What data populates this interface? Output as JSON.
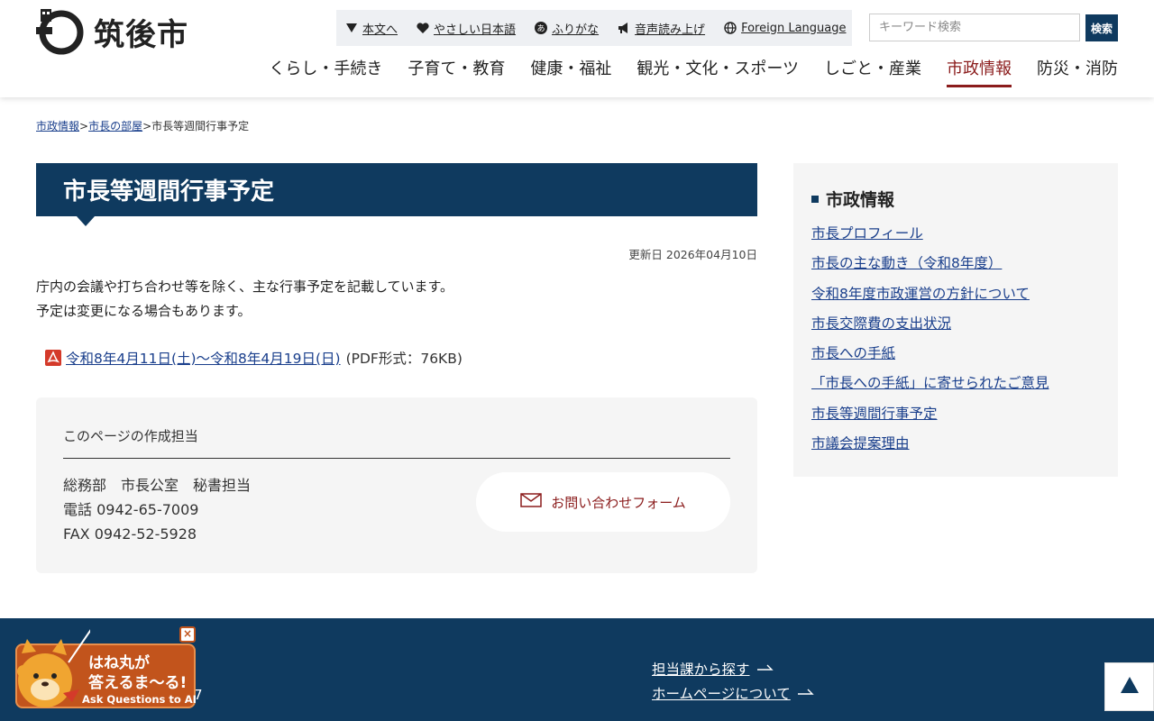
{
  "header": {
    "logo_text": "筑後市",
    "utility": [
      {
        "label": "本文へ",
        "icon": "triangle-down-icon"
      },
      {
        "label": "やさしい日本語",
        "icon": "heart-icon"
      },
      {
        "label": "ふりがな",
        "icon": "a-hiragana-icon"
      },
      {
        "label": "音声読み上げ",
        "icon": "megaphone-icon"
      },
      {
        "label": "Foreign Language",
        "icon": "globe-icon"
      }
    ],
    "search_placeholder": "キーワード検索",
    "search_button": "検索",
    "nav": [
      {
        "label": "くらし・手続き"
      },
      {
        "label": "子育て・教育"
      },
      {
        "label": "健康・福祉"
      },
      {
        "label": "観光・文化・スポーツ"
      },
      {
        "label": "しごと・産業"
      },
      {
        "label": "市政情報",
        "active": true
      },
      {
        "label": "防災・消防"
      }
    ]
  },
  "breadcrumb": {
    "items": [
      "市政情報",
      "市長の部屋"
    ],
    "separator": ">",
    "current": "市長等週間行事予定"
  },
  "main": {
    "title": "市長等週間行事予定",
    "updated": "更新日 2026年04月10日",
    "intro_line1": "庁内の会議や打ち合わせ等を除く、主な行事予定を記載しています。",
    "intro_line2": "予定は変更になる場合もあります。",
    "pdf_link": "令和8年4月11日(土)～令和8年4月19日(日)",
    "pdf_meta": "(PDF形式：76KB)"
  },
  "contact": {
    "heading": "このページの作成担当",
    "department": "総務部　市長公室　秘書担当",
    "tel": "電話 0942-65-7009",
    "fax": "FAX 0942-52-5928",
    "form_button": "お問い合わせフォーム"
  },
  "side": {
    "heading": "市政情報",
    "items": [
      "市長プロフィール",
      "市長の主な動き（令和8年度）",
      "令和8年度市政運営の方針について",
      "市長交際費の支出状況",
      "市長への手紙",
      "「市長への手紙」に寄せられたご意見",
      "市長等週間行事予定",
      "市議会提案理由"
    ]
  },
  "footer": {
    "links": [
      "担当課から探す",
      "ホームページについて"
    ],
    "partial_text": "7"
  },
  "ai_bubble": {
    "line1": "はね丸が",
    "line2": "答えるま〜る!",
    "line3": "Ask Questions to AI",
    "close": "×"
  },
  "colors": {
    "navy": "#0f3a5f",
    "active_red": "#8b1c1c",
    "link_blue": "#1a3f8c",
    "ai_orange": "#c2541c"
  }
}
